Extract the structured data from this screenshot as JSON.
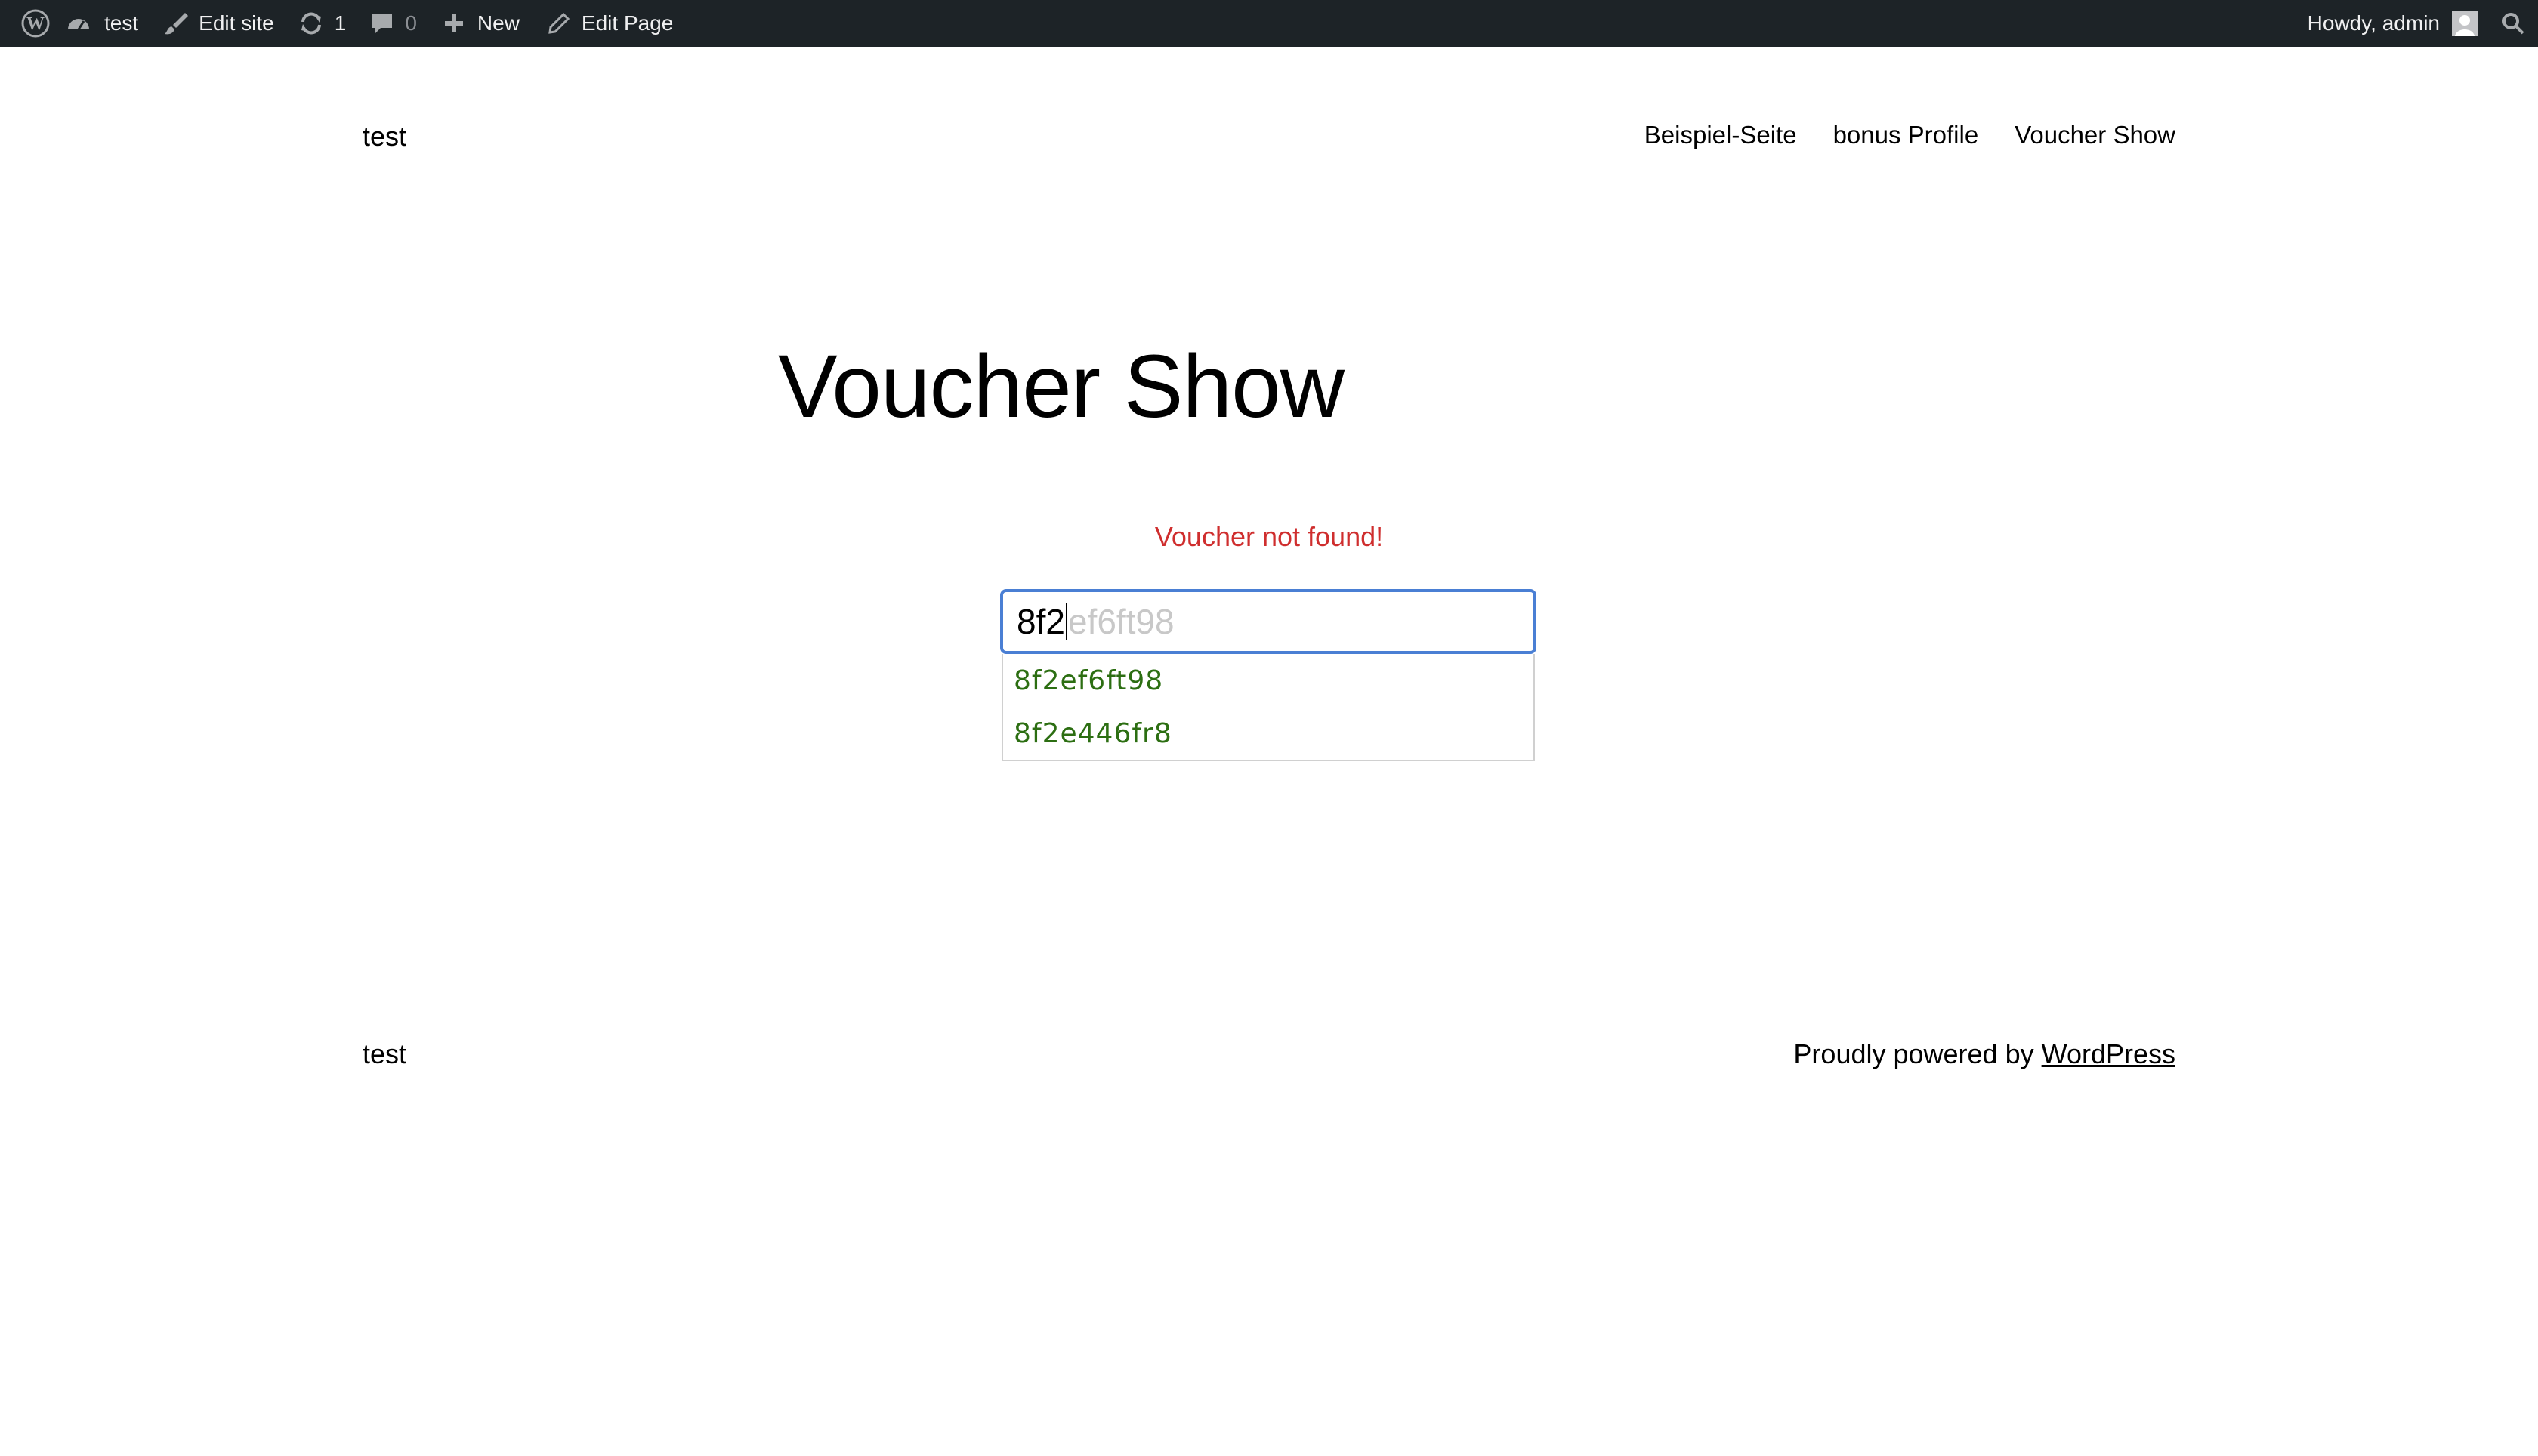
{
  "adminbar": {
    "site_name": "test",
    "edit_site": "Edit site",
    "updates_count": "1",
    "comments_count": "0",
    "new_label": "New",
    "edit_page": "Edit Page",
    "howdy": "Howdy, admin"
  },
  "header": {
    "site_title": "test",
    "nav": [
      "Beispiel-Seite",
      "bonus Profile",
      "Voucher Show"
    ]
  },
  "main": {
    "title": "Voucher Show",
    "error": "Voucher not found!",
    "input_typed": "8f2",
    "input_suggest": "ef6ft98",
    "suggestions": [
      "8f2ef6ft98",
      "8f2e446fr8"
    ]
  },
  "footer": {
    "site_title": "test",
    "credit_prefix": "Proudly powered by ",
    "credit_link": "WordPress"
  },
  "colors": {
    "adminbar_bg": "#1d2327",
    "error": "#cf2e2e",
    "input_border": "#4a7fd4",
    "suggestion_text": "#2c6e12"
  },
  "icons": [
    "wordpress-logo-icon",
    "dashboard-icon",
    "brush-icon",
    "refresh-icon",
    "comment-icon",
    "plus-icon",
    "pencil-icon",
    "search-icon",
    "avatar-icon"
  ]
}
